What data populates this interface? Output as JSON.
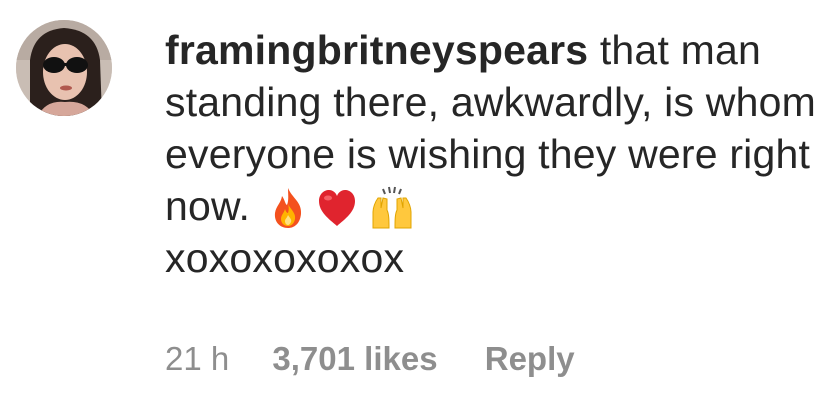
{
  "comment": {
    "username": "framingbritneyspears",
    "text": "that man standing there, awkwardly, is whom everyone is wishing they were right now.",
    "signoff": "xoxoxoxoxox",
    "emojis": [
      "fire-emoji",
      "red-heart-emoji",
      "raising-hands-emoji"
    ],
    "time": "21 h",
    "likes": "3,701 likes",
    "reply_label": "Reply"
  },
  "avatar": {
    "icon": "profile-photo"
  },
  "colors": {
    "text": "#262626",
    "meta": "#8e8e8e",
    "background": "#ffffff"
  }
}
